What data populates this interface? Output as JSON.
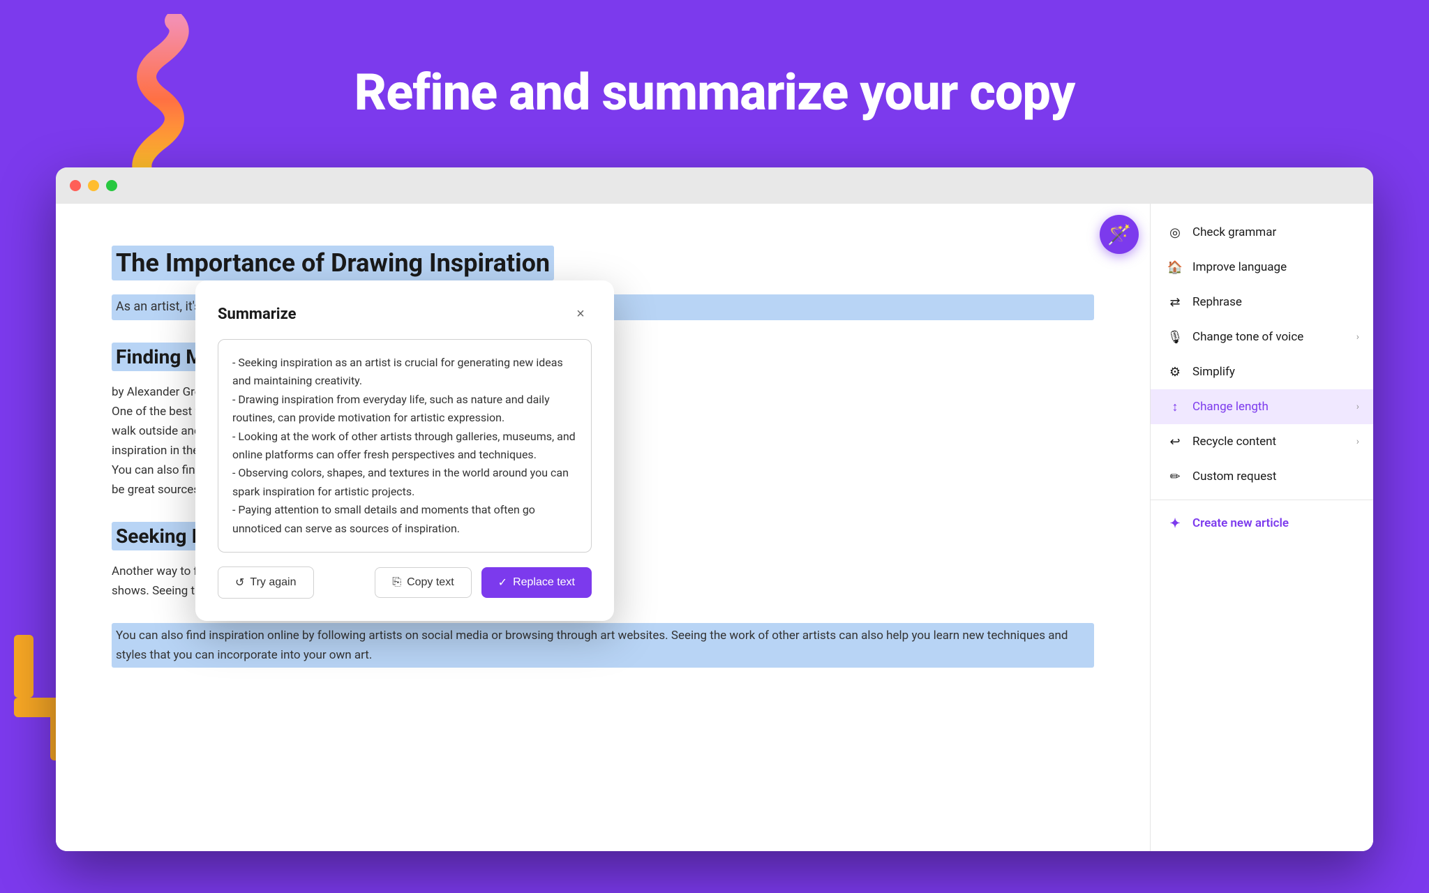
{
  "page": {
    "background_color": "#7c3aed",
    "title": "Refine and summarize your copy"
  },
  "browser": {
    "dots": [
      "red",
      "yellow",
      "green"
    ]
  },
  "document": {
    "title": "The Importance of Drawing Inspiration",
    "intro": "As an artist, it's essential to keep your creativity flowing and pr... techniques by exposing",
    "section1_title": "Finding Motivatio...",
    "section1_body": "by Alexander Grey (http...\nOne of the best ways to...\nwalk outside and observ...\ninspiration in the pattern...\nYou can also find motiva...\nbe great sources of insp...",
    "section2_title": "Seeking Inspirati...",
    "section2_body": "Another way to find insp...\nshows. Seeing the work...\nYou can also find inspiration online by following artists on social media or browsing through art websites. Seeing the work of other artists can also help you learn new techniques and styles that you can incorporate into your own art."
  },
  "modal": {
    "title": "Summarize",
    "close_label": "×",
    "content": "- Seeking inspiration as an artist is crucial for generating new ideas and maintaining creativity.\n- Drawing inspiration from everyday life, such as nature and daily routines, can provide motivation for artistic expression.\n- Looking at the work of other artists through galleries, museums, and online platforms can offer fresh perspectives and techniques.\n- Observing colors, shapes, and textures in the world around you can spark inspiration for artistic projects.\n- Paying attention to small details and moments that often go unnoticed can serve as sources of inspiration.",
    "btn_try_again": "Try again",
    "btn_copy": "Copy text",
    "btn_replace": "Replace text"
  },
  "context_menu": {
    "items": [
      {
        "id": "check-grammar",
        "label": "Check grammar",
        "icon": "✓⊙",
        "has_chevron": false
      },
      {
        "id": "improve-language",
        "label": "Improve language",
        "icon": "💬",
        "has_chevron": false
      },
      {
        "id": "rephrase",
        "label": "Rephrase",
        "icon": "⇄",
        "has_chevron": false
      },
      {
        "id": "change-tone",
        "label": "Change tone of voice",
        "icon": "🎤",
        "has_chevron": true
      },
      {
        "id": "simplify",
        "label": "Simplify",
        "icon": "⚡",
        "has_chevron": false
      },
      {
        "id": "change-length",
        "label": "Change length",
        "icon": "↕",
        "has_chevron": true,
        "active": true
      },
      {
        "id": "recycle-content",
        "label": "Recycle content",
        "icon": "↩",
        "has_chevron": true
      },
      {
        "id": "custom-request",
        "label": "Custom request",
        "icon": "✏️",
        "has_chevron": false
      }
    ],
    "create_new": "Create new article"
  },
  "ai_button": {
    "icon": "🪄"
  }
}
